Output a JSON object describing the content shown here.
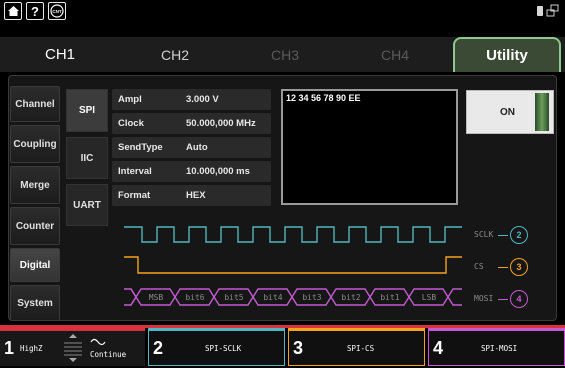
{
  "tabs": [
    "CH1",
    "CH2",
    "CH3",
    "CH4",
    "Utility"
  ],
  "sidebar": {
    "items": [
      {
        "label": "Channel"
      },
      {
        "label": "Coupling"
      },
      {
        "label": "Merge"
      },
      {
        "label": "Counter"
      },
      {
        "label": "Digital"
      },
      {
        "label": "System"
      }
    ]
  },
  "protocols": [
    "SPI",
    "IIC",
    "UART"
  ],
  "params": [
    {
      "label": "Ampl",
      "value": "3.000 V"
    },
    {
      "label": "Clock",
      "value": "50.000,000 MHz"
    },
    {
      "label": "SendType",
      "value": "Auto"
    },
    {
      "label": "Interval",
      "value": "10.000,000 ms"
    },
    {
      "label": "Format",
      "value": "HEX"
    }
  ],
  "data_text": "12 34 56 78 90 EE",
  "output_toggle": "ON",
  "signals": [
    {
      "label": "SCLK",
      "channel": "2",
      "color": "#4fb6c2"
    },
    {
      "label": "CS",
      "channel": "3",
      "color": "#f5a21f"
    },
    {
      "label": "MOSI",
      "channel": "4",
      "color": "#c35ad0"
    }
  ],
  "mosi_bits": [
    "MSB",
    "bit6",
    "bit5",
    "bit4",
    "bit3",
    "bit2",
    "bit1",
    "LSB"
  ],
  "bottom": {
    "ch1": {
      "num": "1",
      "label": "HighZ",
      "mode": "Continue",
      "color": "#d8313e"
    },
    "ch2": {
      "num": "2",
      "label": "SPI-SCLK",
      "color": "#4fb6c2"
    },
    "ch3": {
      "num": "3",
      "label": "SPI-CS",
      "color": "#f5a21f"
    },
    "ch4": {
      "num": "4",
      "label": "SPI-MOSI",
      "color": "#c35ad0"
    }
  },
  "icons": [
    "home-icon",
    "help-icon",
    "counter-icon",
    "battery-icon",
    "network-icon"
  ]
}
